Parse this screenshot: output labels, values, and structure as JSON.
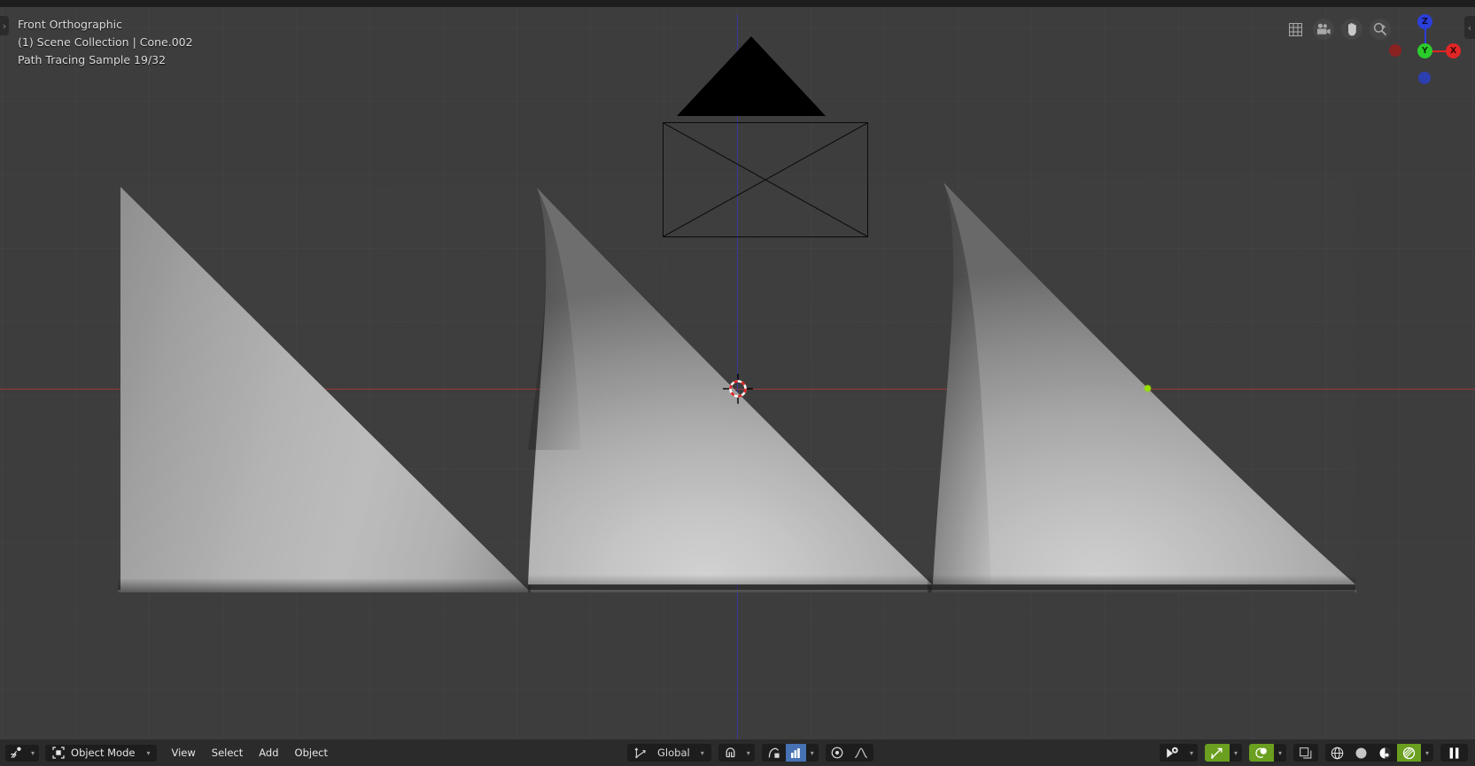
{
  "app": {
    "name": "Blender 3D Viewport",
    "background_color": "#3d3d3d",
    "toolbar_color": "#2b2b2b"
  },
  "viewport_hud": {
    "view_name": "Front Orthographic",
    "scene_line": "(1) Scene Collection | Cone.002",
    "render_status": "Path Tracing Sample 19/32"
  },
  "edge_tabs": {
    "left_toggle": "›",
    "right_toggle": "‹"
  },
  "nav_buttons": [
    {
      "name": "toggle-grid-icon",
      "label": "Toggle Grid"
    },
    {
      "name": "camera-view-icon",
      "label": "Camera View"
    },
    {
      "name": "pan-view-icon",
      "label": "Move View"
    },
    {
      "name": "zoom-view-icon",
      "label": "Zoom View"
    }
  ],
  "gizmo": {
    "axes": [
      {
        "label": "Z",
        "color": "#2b3fd8",
        "position": "top"
      },
      {
        "label": "Y",
        "color": "#2bcc2b",
        "position": "center"
      },
      {
        "label": "X",
        "color": "#e02626",
        "position": "right"
      },
      {
        "label": "",
        "color": "#8b2222",
        "position": "left"
      },
      {
        "label": "",
        "color": "#2b3fb0",
        "position": "bottom"
      }
    ]
  },
  "scene_objects": {
    "camera": {
      "name": "Camera",
      "type": "camera-wireframe"
    },
    "cursor": {
      "name": "3D Cursor",
      "colors": [
        "#e02626",
        "#ffffff"
      ]
    },
    "origin_dot": {
      "name": "Object Origin",
      "color": "#97e000"
    },
    "cones": [
      {
        "name": "Cone",
        "shading": "path-traced-gray"
      },
      {
        "name": "Cone.001",
        "shading": "path-traced-gray"
      },
      {
        "name": "Cone.002",
        "shading": "path-traced-gray",
        "selected": true
      }
    ]
  },
  "toolbar": {
    "editor_type": {
      "label": "Editor Type",
      "icon": "editor-type-icon"
    },
    "mode": {
      "label": "Object Mode",
      "icon": "object-mode-icon"
    },
    "menus": [
      {
        "label": "View"
      },
      {
        "label": "Select"
      },
      {
        "label": "Add"
      },
      {
        "label": "Object"
      }
    ],
    "transform_orientation": {
      "label": "Global",
      "icon": "orientation-axes-icon"
    },
    "snapping": {
      "magnet_label": "Snap",
      "snap_to_label": "Snap To"
    },
    "proportional_editing": {
      "toggle_label": "Proportional Editing",
      "falloff_label": "Falloff Type"
    },
    "right_controls": [
      {
        "name": "object-visibility-icon",
        "label": "Object Types Visibility",
        "active": false
      },
      {
        "name": "gizmo-icon",
        "label": "Show Gizmo",
        "active": true
      },
      {
        "name": "overlays-icon",
        "label": "Show Overlays",
        "active": true
      },
      {
        "name": "xray-icon",
        "label": "Toggle X-Ray",
        "active": false
      }
    ],
    "shading_modes": [
      {
        "name": "wireframe-shading-icon",
        "label": "Wireframe",
        "active": false
      },
      {
        "name": "solid-shading-icon",
        "label": "Solid",
        "active": false
      },
      {
        "name": "material-preview-icon",
        "label": "Material Preview",
        "active": false
      },
      {
        "name": "rendered-shading-icon",
        "label": "Rendered",
        "active": true
      }
    ],
    "pause_render": {
      "name": "pause-render-icon",
      "label": "Pause Render"
    }
  }
}
